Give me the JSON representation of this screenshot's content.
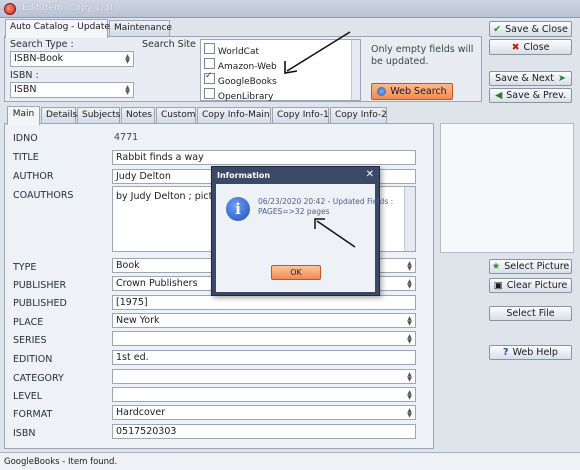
{
  "window": {
    "title": "Edit Item (Copy 1/3)"
  },
  "top_tabs": [
    "Auto Catalog - Update",
    "Maintenance"
  ],
  "search_type": {
    "label": "Search Type :",
    "value": "ISBN-Book"
  },
  "isbn_select": {
    "label": "ISBN :",
    "value": "ISBN"
  },
  "search_site": {
    "label": "Search Site :",
    "sites": [
      {
        "name": "WorldCat",
        "checked": false
      },
      {
        "name": "Amazon-Web",
        "checked": false
      },
      {
        "name": "GoogleBooks",
        "checked": true
      },
      {
        "name": "OpenLibrary",
        "checked": false
      }
    ]
  },
  "empty_note": "Only empty fields will be updated.",
  "web_search_label": "Web Search",
  "buttons": {
    "save_close": "Save & Close",
    "close": "Close",
    "save_next": "Save & Next",
    "save_prev": "Save & Prev.",
    "select_picture": "Select Picture",
    "clear_picture": "Clear Picture",
    "select_file": "Select File",
    "web_help": "Web Help"
  },
  "detail_tabs": [
    "Main",
    "Details",
    "Subjects",
    "Notes",
    "Custom",
    "Copy Info-Main",
    "Copy Info-1",
    "Copy Info-2"
  ],
  "fields": {
    "idno": {
      "label": "IDNO",
      "value": "4771"
    },
    "title": {
      "label": "TITLE",
      "value": "Rabbit finds a way"
    },
    "author": {
      "label": "AUTHOR",
      "value": "Judy Delton"
    },
    "coauthors": {
      "label": "COAUTHORS",
      "value": "by Judy Delton ; pictu"
    },
    "type": {
      "label": "TYPE",
      "value": "Book"
    },
    "publisher": {
      "label": "PUBLISHER",
      "value": "Crown Publishers"
    },
    "published": {
      "label": "PUBLISHED",
      "value": "[1975]"
    },
    "place": {
      "label": "PLACE",
      "value": "New York"
    },
    "series": {
      "label": "SERIES",
      "value": ""
    },
    "edition": {
      "label": "EDITION",
      "value": "1st ed."
    },
    "category": {
      "label": "CATEGORY",
      "value": ""
    },
    "level": {
      "label": "LEVEL",
      "value": ""
    },
    "format": {
      "label": "FORMAT",
      "value": "Hardcover"
    },
    "isbn": {
      "label": "ISBN",
      "value": "0517520303"
    }
  },
  "dialog": {
    "title": "Information",
    "line1": "06/23/2020 20:42 - Updated Fields :",
    "line2": "PAGES=>32 pages",
    "ok": "OK"
  },
  "status": "GoogleBooks - Item found.",
  "colors": {
    "dialog_frame": "#3a4a66",
    "ok_button": "#f28a52",
    "web_search": "#f28a52"
  }
}
